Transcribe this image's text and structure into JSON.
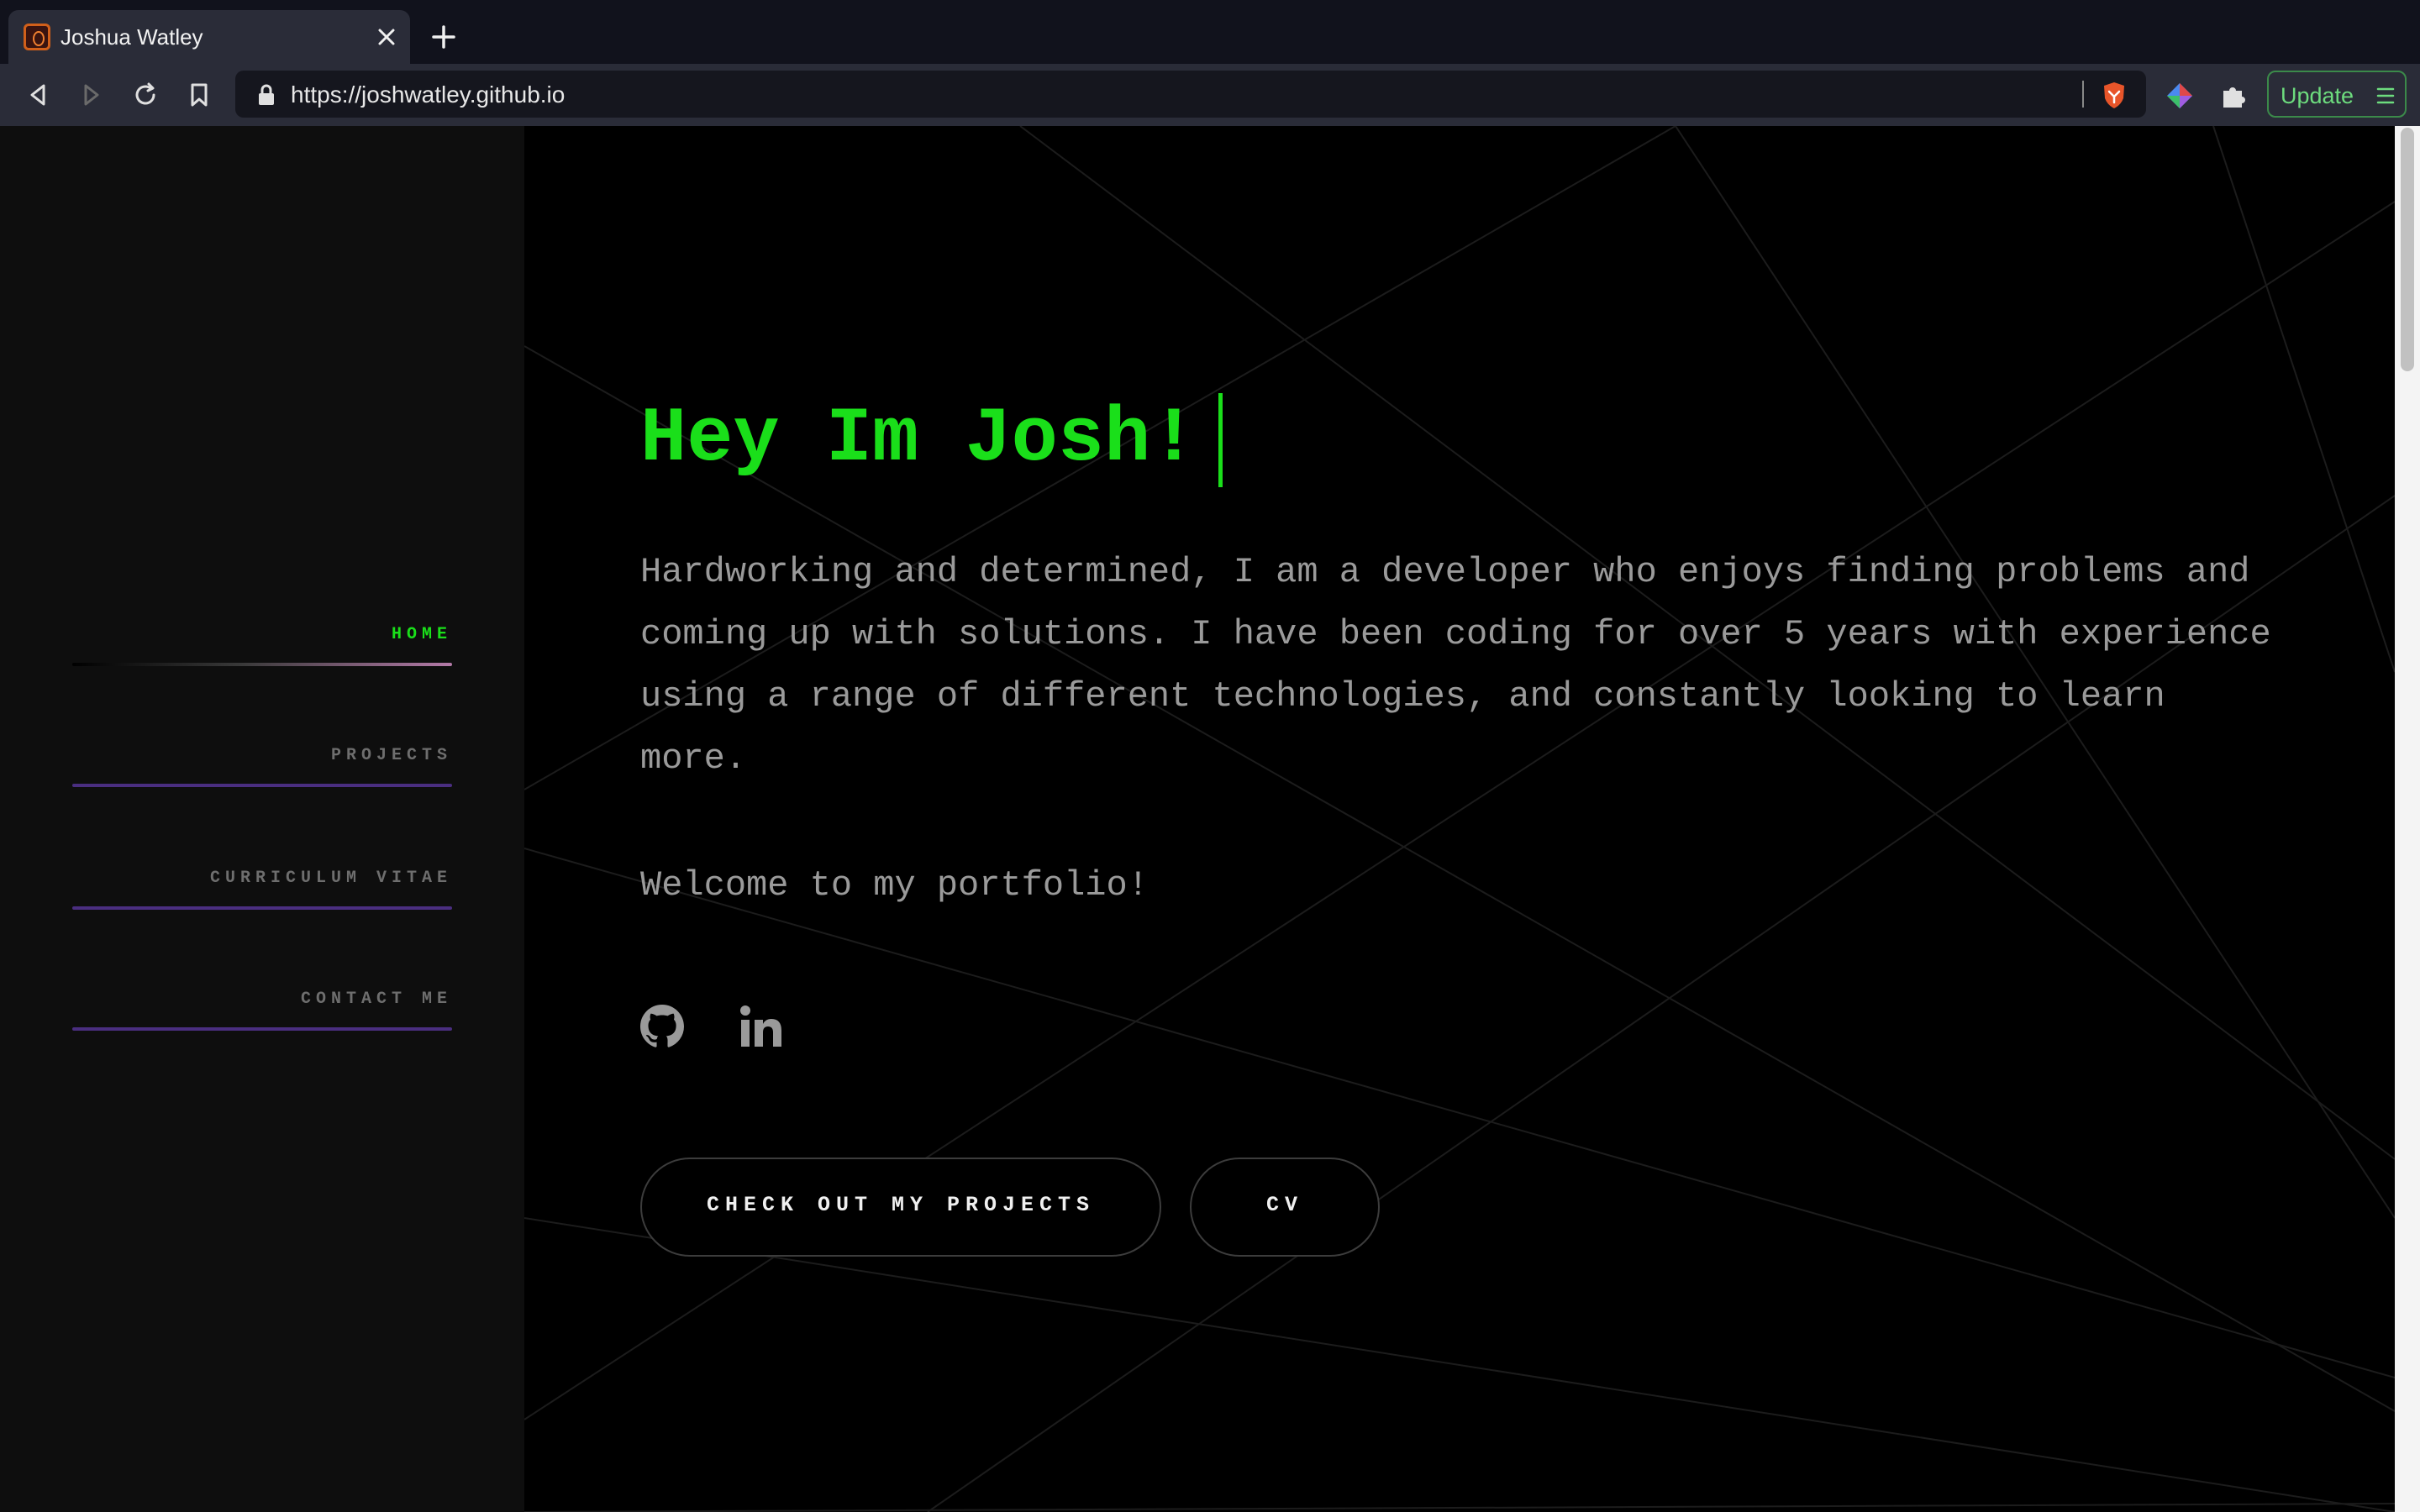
{
  "browser": {
    "tab": {
      "title": "Joshua Watley",
      "favicon": "shield-logo-icon"
    },
    "toolbar": {
      "url": "https://joshwatley.github.io",
      "update_label": "Update"
    },
    "icons": [
      "back-icon",
      "forward-icon",
      "reload-icon",
      "bookmark-icon",
      "lock-icon",
      "brave-shield-icon",
      "extension-icon",
      "puzzle-icon",
      "menu-icon",
      "close-icon",
      "plus-icon"
    ]
  },
  "sidebar": {
    "items": [
      {
        "label": "HOME",
        "active": true
      },
      {
        "label": "PROJECTS",
        "active": false
      },
      {
        "label": "CURRICULUM VITAE",
        "active": false
      },
      {
        "label": "CONTACT ME",
        "active": false
      }
    ]
  },
  "hero": {
    "title": "Hey Im Josh!",
    "intro": "Hardworking and determined, I am a developer who enjoys finding problems and coming up with solutions. I have been coding for over 5 years with experience using a range of different technologies, and constantly looking to learn more.",
    "welcome": "Welcome to my portfolio!",
    "social": [
      "github-icon",
      "linkedin-icon"
    ],
    "buttons": {
      "projects": "CHECK OUT MY PROJECTS",
      "cv": "CV"
    }
  },
  "colors": {
    "accent_green": "#1adf1a",
    "nav_underline": "#4a2e80",
    "text_gray": "#9a9a9a",
    "chrome_bg": "#2a2c38"
  }
}
